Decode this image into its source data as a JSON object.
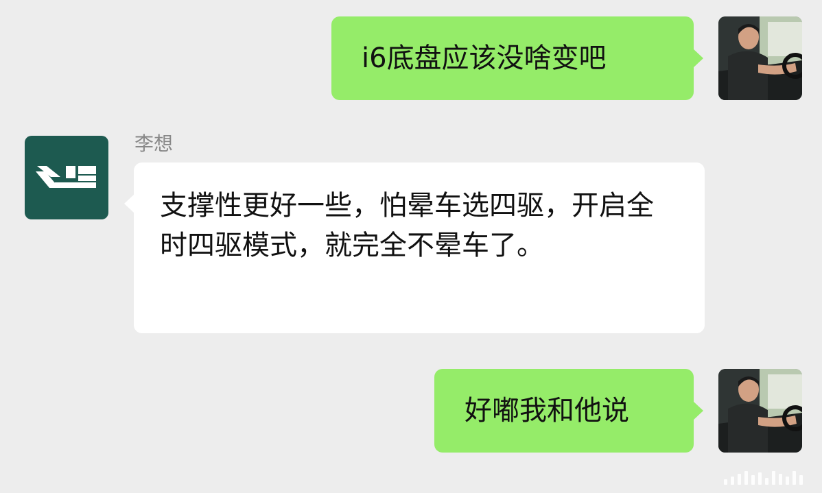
{
  "messages": [
    {
      "direction": "outgoing",
      "text": "i6底盘应该没啥变吧",
      "avatar": "user-driver-photo"
    },
    {
      "direction": "incoming",
      "sender": "李想",
      "text": "支撑性更好一些，怕晕车选四驱，开启全时四驱模式，就完全不晕车了。",
      "avatar": "li-auto-logo"
    },
    {
      "direction": "outgoing",
      "text": "好嘟我和他说",
      "avatar": "user-driver-photo"
    }
  ],
  "colors": {
    "background": "#ededed",
    "outgoing_bubble": "#95ec69",
    "incoming_bubble": "#ffffff",
    "li_auto_brand": "#1d5a50"
  }
}
